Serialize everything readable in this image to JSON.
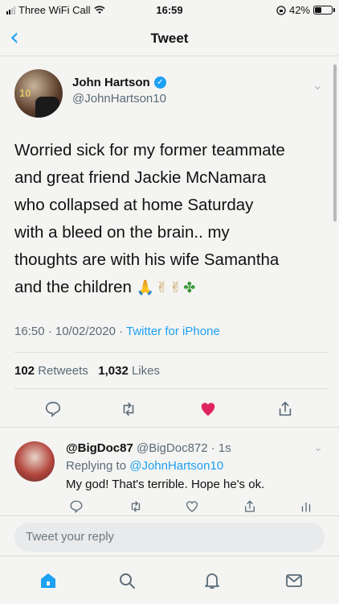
{
  "status_bar": {
    "carrier": "Three WiFi Call",
    "time": "16:59",
    "battery_text": "42%",
    "battery_level": 0.42,
    "icons": [
      "signal-icon",
      "wifi-icon",
      "orientation-lock-icon",
      "battery-icon"
    ]
  },
  "nav": {
    "back_icon": "chevron-left-icon",
    "title": "Tweet"
  },
  "tweet": {
    "author_name": "John Hartson",
    "author_handle": "@JohnHartson10",
    "text_lines": [
      "Worried sick for my former teammate",
      "and great friend Jackie McNamara",
      "who collapsed at home Saturday",
      "with a bleed on the brain.. my",
      "thoughts are with his wife Samantha",
      "and the children"
    ],
    "emoji": [
      "folded-hands",
      "crossed-fingers",
      "crossed-fingers",
      "four-leaf-clover"
    ],
    "timestamp": "16:50 · 10/02/2020 · ",
    "source": "Twitter for iPhone",
    "retweets_count": "102",
    "retweets_label": "Retweets",
    "likes_count": "1,032",
    "likes_label": "Likes",
    "liked": true,
    "colors": {
      "accent": "#1da1f2",
      "like": "#e0245e",
      "muted": "#5b6b78"
    }
  },
  "reply": {
    "author_name": "@BigDoc87",
    "author_handle": "@BigDoc872",
    "age": "· 1s",
    "replying_prefix": "Replying to ",
    "replying_to": "@JohnHartson10",
    "text": "My god! That's terrible. Hope he's ok."
  },
  "compose": {
    "placeholder": "Tweet your reply"
  },
  "tabbar": {
    "items": [
      "home-icon",
      "search-icon",
      "notifications-icon",
      "messages-icon"
    ],
    "active": "home-icon"
  }
}
